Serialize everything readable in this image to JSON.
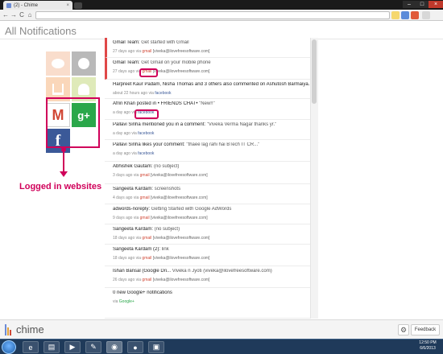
{
  "browser": {
    "tab_title": "(2) - Chime",
    "tab_close": "×",
    "window_controls": {
      "minimize": "–",
      "maximize": "□",
      "close": "×"
    },
    "nav": {
      "back": "←",
      "forward": "→",
      "reload": "C",
      "home": "⌂"
    },
    "address_value": "",
    "extensions": [
      "bookmark-icon",
      "chime-extension-icon",
      "extension-icon",
      "wrench-menu-icon"
    ]
  },
  "app": {
    "page_title": "All Notifications",
    "brand": "chime",
    "feedback_label": "Feedback",
    "settings_icon": "gear-icon",
    "accent": "#d0005a",
    "colors": {
      "unread_marker": "#e04848",
      "gmail": "#d14836",
      "facebook": "#3b5998",
      "google_plus": "#2aa74a"
    }
  },
  "service_tiles": [
    {
      "name": "reddit-tile",
      "icon": "reddit-icon",
      "state": "inactive"
    },
    {
      "name": "github-tile",
      "icon": "github-icon",
      "state": "inactive"
    },
    {
      "name": "stackoverflow-tile",
      "icon": "stackoverflow-icon",
      "state": "inactive"
    },
    {
      "name": "android-tile",
      "icon": "android-icon",
      "state": "inactive"
    },
    {
      "name": "gmail-tile",
      "icon": "gmail-icon",
      "glyph": "M",
      "state": "active"
    },
    {
      "name": "google-plus-tile",
      "icon": "google-plus-icon",
      "glyph": "g+",
      "state": "active"
    },
    {
      "name": "facebook-tile",
      "icon": "facebook-icon",
      "glyph": "f",
      "state": "active"
    }
  ],
  "annotation": {
    "label": "Logged in websites"
  },
  "notifications": [
    {
      "sender": "Gmail Team:",
      "subject": "Get started with Gmail",
      "time": "27 days ago via",
      "service": "gmail",
      "account": "[viveka@ilovefreesoftware.com]",
      "unread": true
    },
    {
      "sender": "Gmail Team:",
      "subject": "Get Gmail on your mobile phone",
      "time": "27 days ago via",
      "service": "gmail",
      "account": "[viveka@ilovefreesoftware.com]",
      "unread": true
    },
    {
      "sender": "Harpreet Kaur Padam, Nisha Thomas and 3 others also commented on Ashutosh Barmaiya...",
      "subject": "",
      "time": "about 22 hours ago via",
      "service": "facebook",
      "account": "",
      "unread": false
    },
    {
      "sender": "Afrin Khan posted in • FRIENDS CHAT• ",
      "subject": "\"New!!\"",
      "time": "a day ago via",
      "service": "facebook",
      "account": "",
      "unread": false
    },
    {
      "sender": "Pallavi Sinha mentioned you in a comment:",
      "subject": "\"Viveka Verma Nagar thanks yr.\"",
      "time": "a day ago via",
      "service": "facebook",
      "account": "",
      "unread": false
    },
    {
      "sender": "Pallavi Sinha likes your comment:",
      "subject": "\"thaee lag rahi hai BTech IT CR...\"",
      "time": "a day ago via",
      "service": "facebook",
      "account": "",
      "unread": false
    },
    {
      "sender": "Abhishek Gautam:",
      "subject": "(no subject)",
      "time": "3 days ago via",
      "service": "gmail",
      "account": "[viveka@ilovefreesoftware.com]",
      "unread": false
    },
    {
      "sender": "Sangeeta Kardam:",
      "subject": "screenshots",
      "time": "4 days ago via",
      "service": "gmail",
      "account": "[viveka@ilovefreesoftware.com]",
      "unread": false
    },
    {
      "sender": "adwords-noreply:",
      "subject": "Getting Started with Google AdWords",
      "time": "9 days ago via",
      "service": "gmail",
      "account": "[viveka@ilovefreesoftware.com]",
      "unread": false
    },
    {
      "sender": "Sangeeta Kardam:",
      "subject": "(no subject)",
      "time": "18 days ago via",
      "service": "gmail",
      "account": "[viveka@ilovefreesoftware.com]",
      "unread": false
    },
    {
      "sender": "Sangeeta Kardam (2):",
      "subject": "link",
      "time": "18 days ago via",
      "service": "gmail",
      "account": "[viveka@ilovefreesoftware.com]",
      "unread": false
    },
    {
      "sender": "Ishan Bansal (Google Dri...",
      "subject": "Viveka n Jyoti (viveka@ilovefreesoftware.com)",
      "time": "26 days ago via",
      "service": "gmail",
      "account": "[viveka@ilovefreesoftware.com]",
      "unread": false
    },
    {
      "sender": "0 new Google+ notifications",
      "subject": "",
      "time": "via",
      "service": "Google+",
      "account": "",
      "unread": false
    }
  ],
  "service_labels": {
    "gmail": "gmail",
    "facebook": "facebook",
    "Google+": "Google+"
  },
  "taskbar": {
    "apps": [
      "internet-explorer-icon",
      "file-explorer-icon",
      "media-player-icon",
      "paint-icon",
      "chrome-icon",
      "firefox-icon",
      "remote-icon"
    ],
    "time": "12:50 PM",
    "date": "6/6/2013"
  }
}
